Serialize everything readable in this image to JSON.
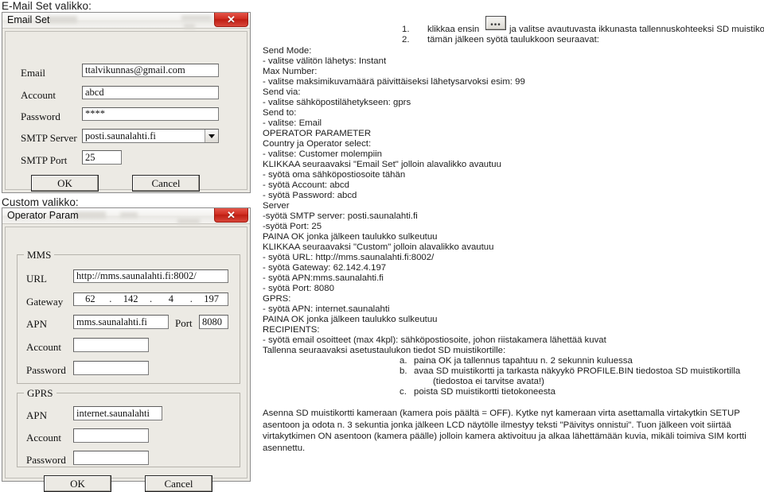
{
  "captions": {
    "email_set": "E-Mail Set valikko:",
    "custom": "Custom valikko:"
  },
  "email_dialog": {
    "title": "Email Set",
    "close_glyph": "✕",
    "fields": [
      {
        "label": "Email",
        "value": "ttalvikunnas@gmail.com"
      },
      {
        "label": "Account",
        "value": "abcd"
      },
      {
        "label": "Password",
        "value": "****"
      },
      {
        "label": "SMTP Server",
        "value": "posti.saunalahti.fi"
      },
      {
        "label": "SMTP Port",
        "value": "25"
      }
    ],
    "ok_label": "OK",
    "cancel_label": "Cancel"
  },
  "operator_dialog": {
    "title": "Operator Param",
    "close_glyph": "✕",
    "mms": {
      "group_label": "MMS",
      "url_label": "URL",
      "url_value": "http://mms.saunalahti.fi:8002/",
      "gateway_label": "Gateway",
      "gateway_octets": [
        "62",
        "142",
        "4",
        "197"
      ],
      "gateway_separator": ".",
      "apn_label": "APN",
      "apn_value": "mms.saunalahti.fi",
      "port_label": "Port",
      "port_value": "8080",
      "account_label": "Account",
      "account_value": "",
      "password_label": "Password",
      "password_value": ""
    },
    "gprs": {
      "group_label": "GPRS",
      "apn_label": "APN",
      "apn_value": "internet.saunalahti",
      "account_label": "Account",
      "account_value": "",
      "password_label": "Password",
      "password_value": ""
    },
    "ok_label": "OK",
    "cancel_label": "Cancel"
  },
  "instructions": {
    "step1_num": "1.",
    "step1_before": "klikkaa ensin",
    "step1_button_glyph": "•••",
    "step1_after": "ja valitse avautuvasta ikkunasta tallennuskohteeksi SD muistikortti",
    "step2_num": "2.",
    "step2_text": "tämän jälkeen syötä taulukkoon seuraavat:",
    "lines": [
      "Send Mode:",
      "- valitse välitön lähetys: Instant",
      "Max Number:",
      "- valitse maksimikuvamäärä päivittäiseksi lähetysarvoksi esim: 99",
      "Send via:",
      "- valitse sähköpostilähetykseen: gprs",
      "Send to:",
      "- valitse: Email",
      "OPERATOR PARAMETER",
      "Country ja Operator select:",
      "- valitse: Customer molempiin",
      "KLIKKAA seuraavaksi \"Email Set\" jolloin alavalikko avautuu",
      "- syötä oma sähköpostiosoite tähän",
      "- syötä Account: abcd",
      " - syötä Password: abcd",
      "Server",
      "-syötä SMTP server: posti.saunalahti.fi",
      "-syötä Port: 25",
      "PAINA OK jonka jälkeen taulukko sulkeutuu",
      "KLIKKAA seuraavaksi \"Custom\" jolloin alavalikko avautuu",
      "- syötä URL: http://mms.saunalahti.fi:8002/",
      "- syötä Gateway: 62.142.4.197",
      "- syötä APN:mms.saunalahti.fi",
      "- syötä Port: 8080",
      "GPRS:",
      "- syötä APN: internet.saunalahti",
      "PAINA OK jonka jälkeen taulukko sulkeutuu",
      "RECIPIENTS:",
      "- syötä email osoitteet (max 4kpl): sähköpostiosoite, johon riistakamera lähettää kuvat",
      "Tallenna seuraavaksi asetustaulukon tiedot SD muistikortille:"
    ],
    "sub_items": [
      {
        "marker": "a.",
        "text": "paina OK ja tallennus tapahtuu n. 2 sekunnin kuluessa",
        "cont": ""
      },
      {
        "marker": "b.",
        "text": "avaa SD muistikortti ja tarkasta näkyykö PROFILE.BIN tiedostoa SD muistikortilla",
        "cont": "(tiedostoa ei tarvitse avata!)"
      },
      {
        "marker": "c.",
        "text": "poista SD muistikortti tietokoneesta",
        "cont": ""
      }
    ],
    "closing_paragraph": "Asenna SD muistikortti kameraan (kamera pois päältä = OFF). Kytke nyt kameraan virta asettamalla virtakytkin SETUP asentoon ja odota n. 3 sekuntia jonka jälkeen LCD näytölle ilmestyy teksti \"Päivitys onnistui\". Tuon jälkeen voit siirtää virtakytkimen ON asentoon (kamera päälle) jolloin kamera aktivoituu ja alkaa lähettämään kuvia, mikäli toimiva SIM kortti asennettu."
  },
  "colors": {
    "dialog_face": "#eceae4",
    "close_button_red": "#cf2d21",
    "text": "#1d1d1d"
  }
}
